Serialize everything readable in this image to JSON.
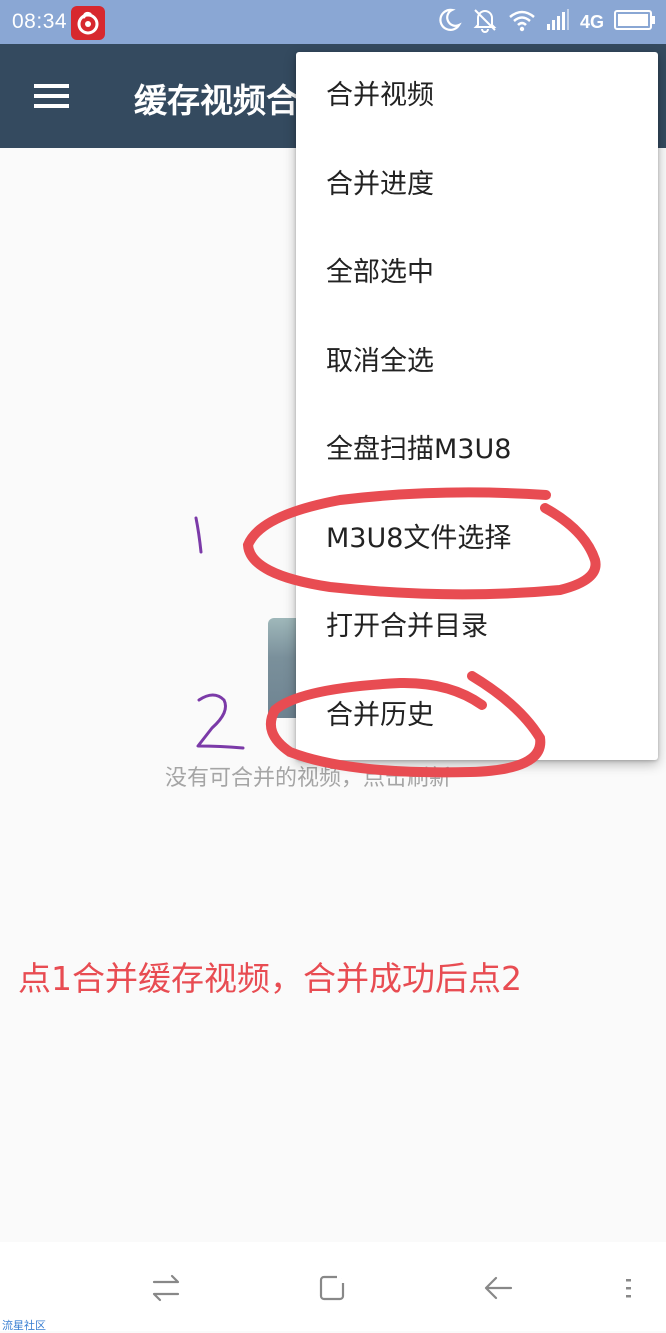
{
  "status_bar": {
    "time": "08:34",
    "network": "4G",
    "icons": [
      "netease-music-icon",
      "moon-icon",
      "bell-off-icon",
      "wifi-icon",
      "signal-icon",
      "battery-icon"
    ]
  },
  "app_bar": {
    "title": "缓存视频合并",
    "menu_icon": "hamburger-menu-icon",
    "background": "#344a5f"
  },
  "overflow_menu": {
    "items": [
      {
        "label": "合并视频"
      },
      {
        "label": "合并进度"
      },
      {
        "label": "全部选中"
      },
      {
        "label": "取消全选"
      },
      {
        "label": "全盘扫描M3U8"
      },
      {
        "label": "M3U8文件选择"
      },
      {
        "label": "打开合并目录"
      },
      {
        "label": "合并历史"
      }
    ]
  },
  "empty_state": {
    "message": "没有可合并的视频，点击刷新"
  },
  "annotation": {
    "marker_1": "1",
    "marker_2": "2",
    "instruction": "点1合并缓存视频，合并成功后点2",
    "color": "#e84c52",
    "marker_color": "#7b3aa8"
  },
  "nav_bar": {
    "icons": [
      "switch-apps-icon",
      "home-square-icon",
      "back-arrow-icon",
      "menu-dots-icon"
    ]
  },
  "watermark": "流星社区"
}
